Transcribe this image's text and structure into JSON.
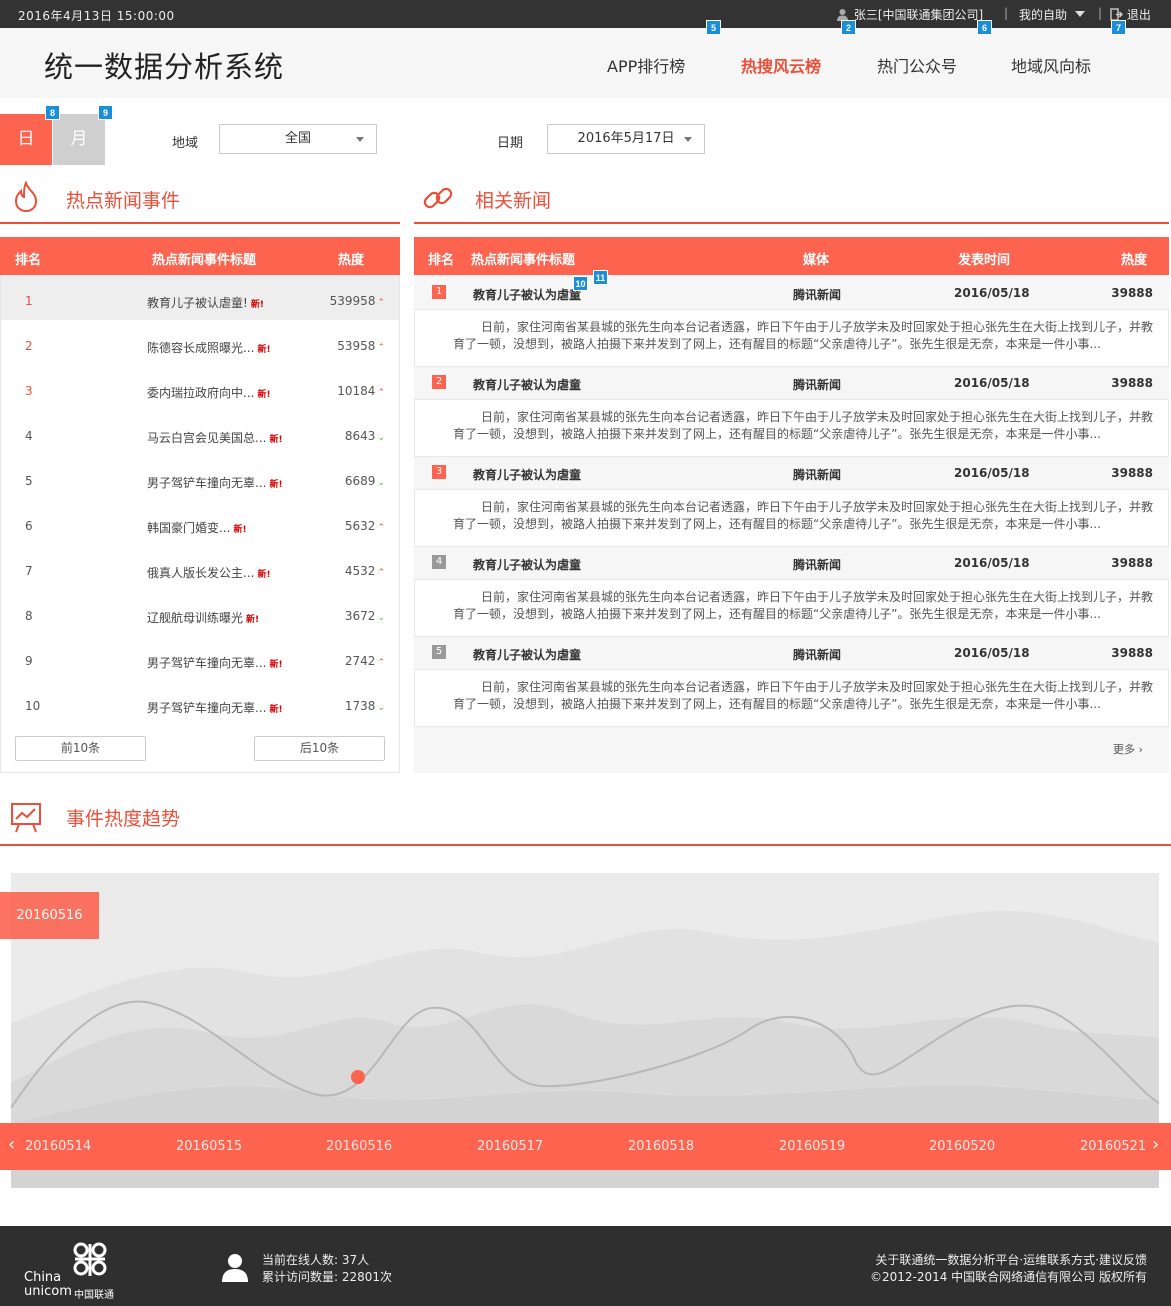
{
  "topbar": {
    "datetime": "2016年4月13日   15:00:00",
    "user": "张三[中国联通集团公司]",
    "help": "我的自助",
    "logout": "退出"
  },
  "header": {
    "title": "统一数据分析系统",
    "nav": [
      "APP排行榜",
      "热搜风云榜",
      "热门公众号",
      "地域风向标"
    ],
    "active_nav": "热搜风云榜"
  },
  "badges": [
    "2",
    "5",
    "6",
    "7",
    "8",
    "9",
    "10",
    "11"
  ],
  "filters": {
    "day_tab": "日",
    "month_tab": "月",
    "region_label": "地域",
    "region_value": "全国",
    "date_label": "日期",
    "date_value": "2016年5月17日"
  },
  "hot_events": {
    "title": "热点新闻事件",
    "columns": [
      "排名",
      "热点新闻事件标题",
      "热度"
    ],
    "new_tag": "新!",
    "rows": [
      {
        "rank": "1",
        "title": "教育儿子被认虐童!",
        "heat": "539958",
        "trend": "up"
      },
      {
        "rank": "2",
        "title": "陈德容长成照曝光...",
        "heat": "53958",
        "trend": "up"
      },
      {
        "rank": "3",
        "title": "委内瑞拉政府向中...",
        "heat": "10184",
        "trend": "up"
      },
      {
        "rank": "4",
        "title": "马云白宫会见美国总...",
        "heat": "8643",
        "trend": "down"
      },
      {
        "rank": "5",
        "title": "男子驾铲车撞向无辜...",
        "heat": "6689",
        "trend": "down"
      },
      {
        "rank": "6",
        "title": "韩国豪门婚变...",
        "heat": "5632",
        "trend": "up"
      },
      {
        "rank": "7",
        "title": "俄真人版长发公主...",
        "heat": "4532",
        "trend": "up"
      },
      {
        "rank": "8",
        "title": "辽舰航母训练曝光",
        "heat": "3672",
        "trend": "down"
      },
      {
        "rank": "9",
        "title": "男子驾铲车撞向无辜...",
        "heat": "2742",
        "trend": "up"
      },
      {
        "rank": "10",
        "title": "男子驾铲车撞向无辜...",
        "heat": "1738",
        "trend": "down"
      }
    ],
    "prev_label": "前10条",
    "next_label": "后10条"
  },
  "related_news": {
    "title": "相关新闻",
    "columns": [
      "排名",
      "热点新闻事件标题",
      "媒体",
      "发表时间",
      "热度"
    ],
    "rows": [
      {
        "rank": "1",
        "title": "教育儿子被认为虐童",
        "media": "腾讯新闻",
        "date": "2016/05/18",
        "heat": "39888",
        "summary": "日前，家住河南省某县城的张先生向本台记者透露，昨日下午由于儿子放学未及时回家处于担心张先生在大街上找到儿子，并教育了一顿，没想到，被路人拍摄下来并发到了网上，还有醒目的标题“父亲虐待儿子”。张先生很是无奈，本来是一件小事...",
        "color": "#fd6450"
      },
      {
        "rank": "2",
        "title": "教育儿子被认为虐童",
        "media": "腾讯新闻",
        "date": "2016/05/18",
        "heat": "39888",
        "summary": "日前，家住河南省某县城的张先生向本台记者透露，昨日下午由于儿子放学未及时回家处于担心张先生在大街上找到儿子，并教育了一顿，没想到，被路人拍摄下来并发到了网上，还有醒目的标题“父亲虐待儿子”。张先生很是无奈，本来是一件小事...",
        "color": "#fd6450"
      },
      {
        "rank": "3",
        "title": "教育儿子被认为虐童",
        "media": "腾讯新闻",
        "date": "2016/05/18",
        "heat": "39888",
        "summary": "日前，家住河南省某县城的张先生向本台记者透露，昨日下午由于儿子放学未及时回家处于担心张先生在大街上找到儿子，并教育了一顿，没想到，被路人拍摄下来并发到了网上，还有醒目的标题“父亲虐待儿子”。张先生很是无奈，本来是一件小事...",
        "color": "#fd6450"
      },
      {
        "rank": "4",
        "title": "教育儿子被认为虐童",
        "media": "腾讯新闻",
        "date": "2016/05/18",
        "heat": "39888",
        "summary": "日前，家住河南省某县城的张先生向本台记者透露，昨日下午由于儿子放学未及时回家处于担心张先生在大街上找到儿子，并教育了一顿，没想到，被路人拍摄下来并发到了网上，还有醒目的标题“父亲虐待儿子”。张先生很是无奈，本来是一件小事...",
        "color": "#999999"
      },
      {
        "rank": "5",
        "title": "教育儿子被认为虐童",
        "media": "腾讯新闻",
        "date": "2016/05/18",
        "heat": "39888",
        "summary": "日前，家住河南省某县城的张先生向本台记者透露，昨日下午由于儿子放学未及时回家处于担心张先生在大街上找到儿子，并教育了一顿，没想到，被路人拍摄下来并发到了网上，还有醒目的标题“父亲虐待儿子”。张先生很是无奈，本来是一件小事...",
        "color": "#999999"
      }
    ],
    "more_label": "更多 ›"
  },
  "trend": {
    "title": "事件热度趋势",
    "selected_date": "20160516",
    "timeline": [
      "20160514",
      "20160515",
      "20160516",
      "20160517",
      "20160518",
      "20160519",
      "20160520",
      "20160521"
    ],
    "prev_arrow": "‹",
    "next_arrow": "›"
  },
  "footer": {
    "logo_en1": "China",
    "logo_en2": "unicom",
    "logo_cn": "中国联通",
    "online_label": "当前在线人数: 37人",
    "visits_label": "累计访问数量: 22801次",
    "links": "关于联通统一数据分析平台·运维联系方式·建议反馈",
    "copyright": "©2012-2014 中国联合网络通信有限公司 版权所有"
  }
}
